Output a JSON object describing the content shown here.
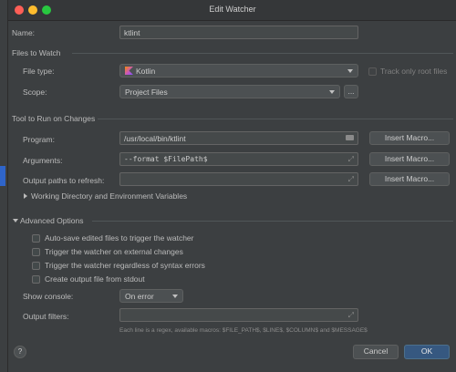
{
  "window": {
    "title": "Edit Watcher"
  },
  "name": {
    "label": "Name:",
    "value": "ktlint"
  },
  "files_to_watch": {
    "section": "Files to Watch",
    "file_type_label": "File type:",
    "file_type_value": "Kotlin",
    "file_type_icon": "kotlin-icon",
    "track_root_label": "Track only root files",
    "scope_label": "Scope:",
    "scope_value": "Project Files",
    "scope_more": "..."
  },
  "tool": {
    "section": "Tool to Run on Changes",
    "program_label": "Program:",
    "program_value": "/usr/local/bin/ktlint",
    "arguments_label": "Arguments:",
    "arguments_value": "--format $FilePath$",
    "output_paths_label": "Output paths to refresh:",
    "output_paths_value": "",
    "insert_macro": "Insert Macro...",
    "working_dir_label": "Working Directory and Environment Variables"
  },
  "advanced": {
    "section": "Advanced Options",
    "options": [
      {
        "label": "Auto-save edited files to trigger the watcher",
        "checked": false
      },
      {
        "label": "Trigger the watcher on external changes",
        "checked": false
      },
      {
        "label": "Trigger the watcher regardless of syntax errors",
        "checked": false
      },
      {
        "label": "Create output file from stdout",
        "checked": false
      }
    ],
    "show_console_label": "Show console:",
    "show_console_value": "On error",
    "output_filters_label": "Output filters:",
    "output_filters_value": "",
    "hint": "Each line is a regex, available macros: $FILE_PATH$, $LINE$, $COLUMN$ and $MESSAGE$"
  },
  "footer": {
    "help": "?",
    "cancel": "Cancel",
    "ok": "OK"
  },
  "colors": {
    "accent": "#365880",
    "background": "#3c3f41",
    "field": "#45494a"
  }
}
